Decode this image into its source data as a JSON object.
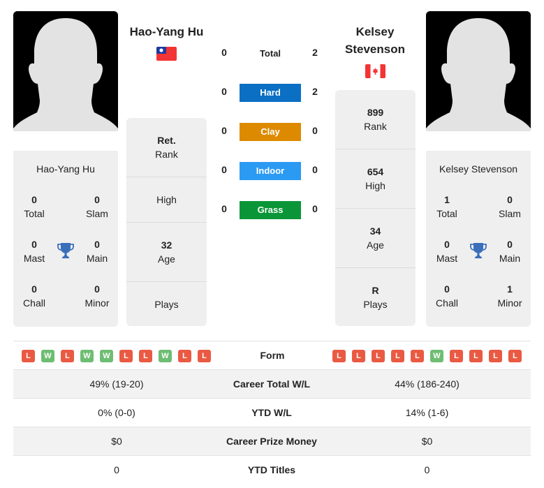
{
  "player1": {
    "name": "Hao-Yang Hu",
    "flag": "taiwan-flag",
    "titles": {
      "total": "0",
      "slam": "0",
      "mast": "0",
      "main": "0",
      "chall": "0",
      "minor": "0"
    },
    "info": {
      "rank_value": "Ret.",
      "rank_label": "Rank",
      "high_value": "",
      "high_label": "High",
      "age_value": "32",
      "age_label": "Age",
      "plays_value": "",
      "plays_label": "Plays"
    },
    "form": [
      "L",
      "W",
      "L",
      "W",
      "W",
      "L",
      "L",
      "W",
      "L",
      "L"
    ]
  },
  "player2": {
    "name_line1": "Kelsey",
    "name_line2": "Stevenson",
    "name": "Kelsey Stevenson",
    "flag": "canada-flag",
    "titles": {
      "total": "1",
      "slam": "0",
      "mast": "0",
      "main": "0",
      "chall": "0",
      "minor": "1"
    },
    "info": {
      "rank_value": "899",
      "rank_label": "Rank",
      "high_value": "654",
      "high_label": "High",
      "age_value": "34",
      "age_label": "Age",
      "plays_value": "R",
      "plays_label": "Plays"
    },
    "form": [
      "L",
      "L",
      "L",
      "L",
      "L",
      "W",
      "L",
      "L",
      "L",
      "L"
    ]
  },
  "title_labels": {
    "total": "Total",
    "slam": "Slam",
    "mast": "Mast",
    "main": "Main",
    "chall": "Chall",
    "minor": "Minor"
  },
  "h2h": {
    "total": {
      "label": "Total",
      "p1": "0",
      "p2": "2"
    },
    "surfaces": [
      {
        "label": "Hard",
        "p1": "0",
        "p2": "2",
        "color": "#0b6fc4"
      },
      {
        "label": "Clay",
        "p1": "0",
        "p2": "0",
        "color": "#dd8a00"
      },
      {
        "label": "Indoor",
        "p1": "0",
        "p2": "0",
        "color": "#2b9af3"
      },
      {
        "label": "Grass",
        "p1": "0",
        "p2": "0",
        "color": "#0a9638"
      }
    ]
  },
  "form_label": "Form",
  "comparison": [
    {
      "label": "Career Total W/L",
      "p1": "49% (19-20)",
      "p2": "44% (186-240)"
    },
    {
      "label": "YTD W/L",
      "p1": "0% (0-0)",
      "p2": "14% (1-6)"
    },
    {
      "label": "Career Prize Money",
      "p1": "$0",
      "p2": "$0"
    },
    {
      "label": "YTD Titles",
      "p1": "0",
      "p2": "0"
    }
  ],
  "colors": {
    "loss": "#ea5a43",
    "win": "#6fbd73",
    "card_bg": "#efefef",
    "trophy": "#3a6fba"
  }
}
